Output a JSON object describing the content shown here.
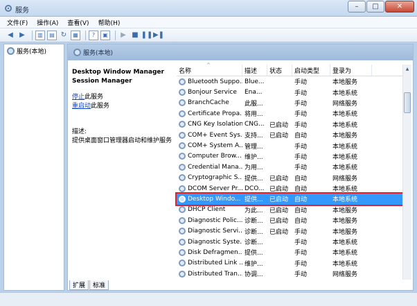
{
  "window": {
    "title": "服务"
  },
  "menu": [
    "文件(F)",
    "操作(A)",
    "查看(V)",
    "帮助(H)"
  ],
  "tree": {
    "root": "服务(本地)"
  },
  "panel": {
    "header": "服务(本地)"
  },
  "desc": {
    "title_line1": "Desktop Window Manager",
    "title_line2": "Session Manager",
    "stop_link": "停止",
    "stop_suffix": "此服务",
    "restart_link": "重启动",
    "restart_suffix": "此服务",
    "label": "描述:",
    "text": "提供桌面窗口管理器启动和维护服务"
  },
  "table": {
    "columns": [
      "名称",
      "描述",
      "状态",
      "启动类型",
      "登录为"
    ],
    "rows": [
      [
        "Bluetooth Suppo...",
        "Blue...",
        "",
        "手动",
        "本地服务"
      ],
      [
        "Bonjour Service",
        "Ena...",
        "",
        "手动",
        "本地系统"
      ],
      [
        "BranchCache",
        "此服...",
        "",
        "手动",
        "网络服务"
      ],
      [
        "Certificate Propa...",
        "将用...",
        "",
        "手动",
        "本地系统"
      ],
      [
        "CNG Key Isolation",
        "CNG...",
        "已启动",
        "手动",
        "本地系统"
      ],
      [
        "COM+ Event Sys...",
        "支持...",
        "已启动",
        "自动",
        "本地服务"
      ],
      [
        "COM+ System A...",
        "管理...",
        "",
        "手动",
        "本地系统"
      ],
      [
        "Computer Brow...",
        "维护...",
        "",
        "手动",
        "本地系统"
      ],
      [
        "Credential Mana...",
        "为用...",
        "",
        "手动",
        "本地系统"
      ],
      [
        "Cryptographic S...",
        "提供...",
        "已启动",
        "自动",
        "网络服务"
      ],
      [
        "DCOM Server Pr...",
        "DCO...",
        "已启动",
        "自动",
        "本地系统"
      ],
      [
        "Desktop Windo...",
        "提供...",
        "已启动",
        "自动",
        "本地系统"
      ],
      [
        "DHCP Client",
        "为此...",
        "已启动",
        "自动",
        "本地服务"
      ],
      [
        "Diagnostic Polic...",
        "诊断...",
        "已启动",
        "自动",
        "本地服务"
      ],
      [
        "Diagnostic Servi...",
        "诊断...",
        "已启动",
        "手动",
        "本地服务"
      ],
      [
        "Diagnostic Syste...",
        "诊断...",
        "",
        "手动",
        "本地系统"
      ],
      [
        "Disk Defragmen...",
        "提供...",
        "",
        "手动",
        "本地系统"
      ],
      [
        "Distributed Link ...",
        "维护...",
        "",
        "手动",
        "本地系统"
      ],
      [
        "Distributed Tran...",
        "协调...",
        "",
        "手动",
        "网络服务"
      ]
    ],
    "selected_index": 11
  },
  "tabs": [
    "扩展",
    "标准"
  ],
  "colors": {
    "selection": "#3399ff",
    "highlight_box": "#e0202a",
    "link": "#1a48c4"
  }
}
